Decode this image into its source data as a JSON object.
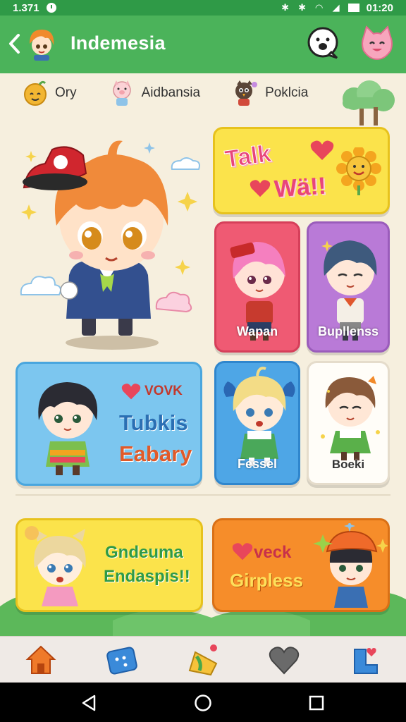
{
  "status_bar": {
    "time": "1.371",
    "clock_right": "01:20"
  },
  "app_bar": {
    "title": "Indemesia"
  },
  "filters": [
    {
      "label": "Ory",
      "icon": "smiley-face-icon"
    },
    {
      "label": "Aidbansia",
      "icon": "pig-character-icon"
    },
    {
      "label": "Poklcia",
      "icon": "bird-character-icon"
    }
  ],
  "cards": {
    "talk": {
      "line1": "Talk",
      "line2": "Wä!!"
    },
    "wapan": {
      "label": "Wapan"
    },
    "bupllenss": {
      "label": "Bupllenss"
    },
    "tubkis": {
      "tag": "VOVK",
      "line1": "Tubkis",
      "line2": "Eabary"
    },
    "fessel": {
      "label": "Fessel"
    },
    "boeki": {
      "label": "Boeki"
    },
    "gndeuma": {
      "line1": "Gndeuma",
      "line2": "Endaspis!!"
    },
    "girpless": {
      "tag": "veck",
      "line1": "Girpless"
    }
  },
  "bottom_nav": [
    "home-icon",
    "dice-icon",
    "toy-icon",
    "heart-icon",
    "boot-icon"
  ],
  "colors": {
    "appbar": "#4bb35a",
    "statusbar": "#2f9a47",
    "background": "#f6efde",
    "talk": "#fbe34b",
    "wapan": "#ef5a73",
    "bupllenss": "#b97ad7",
    "tubkis": "#7cc6ef",
    "fessel": "#4ea6e6",
    "girpless": "#f68d2a"
  }
}
